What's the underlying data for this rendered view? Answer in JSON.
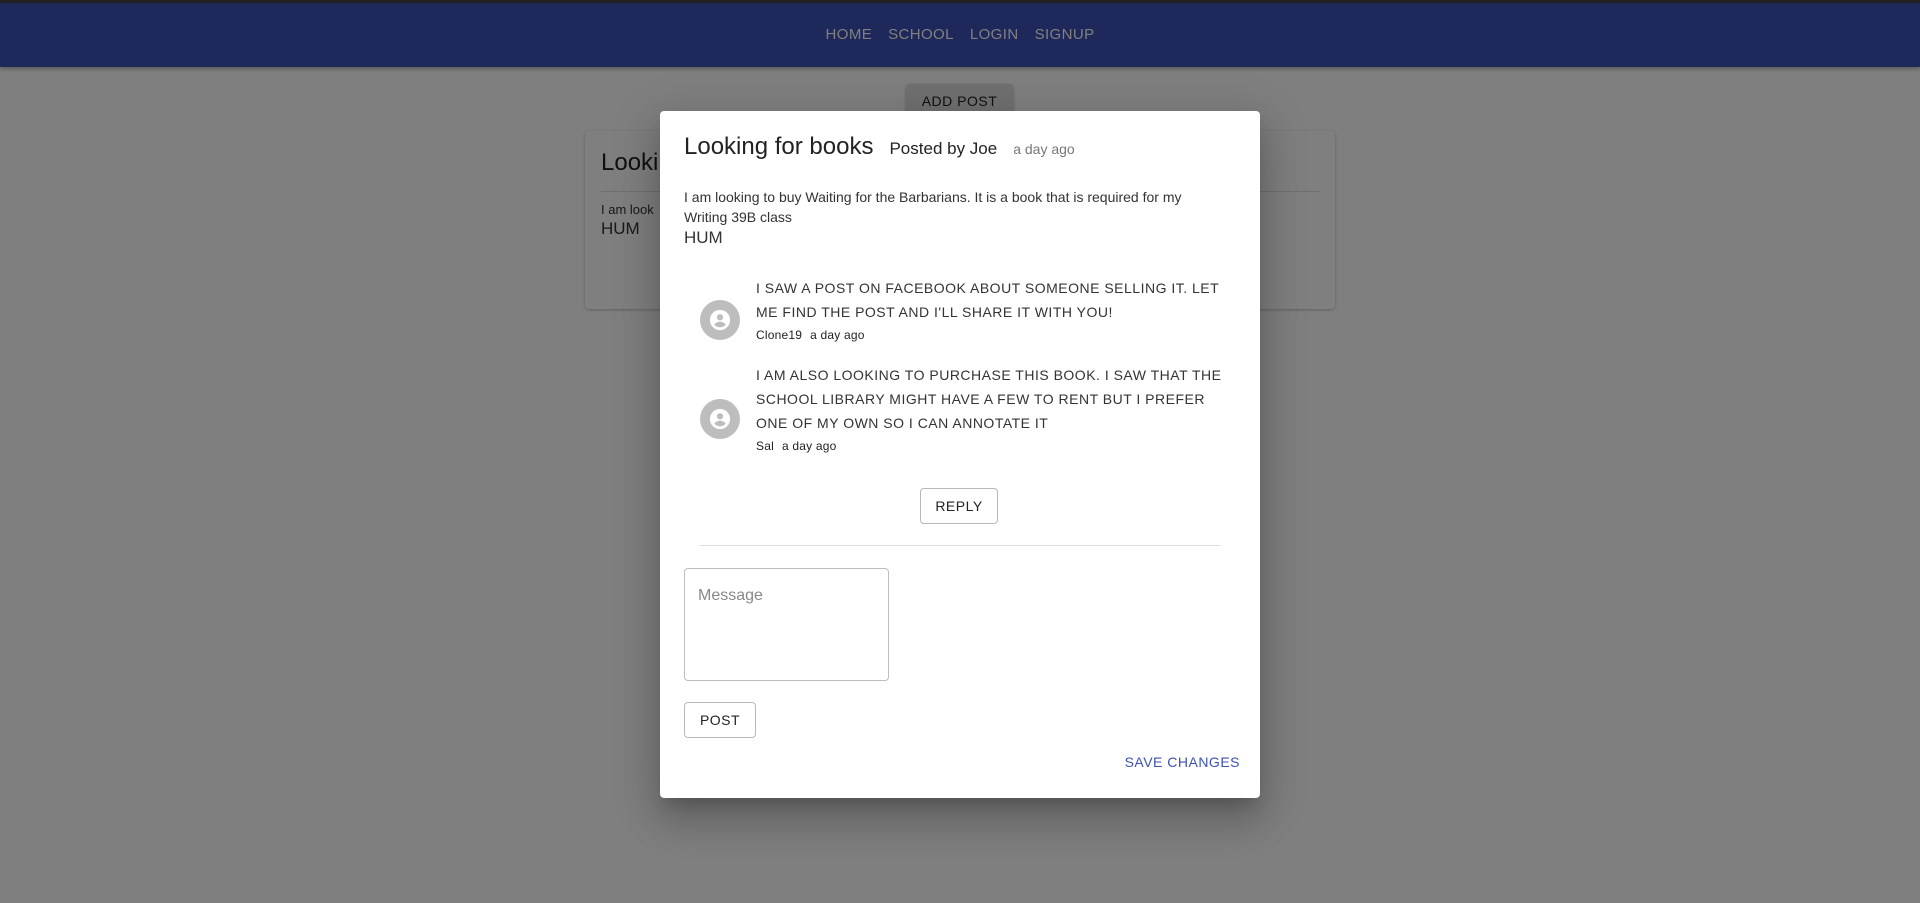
{
  "nav": {
    "items": [
      "HOME",
      "SCHOOL",
      "LOGIN",
      "SIGNUP"
    ]
  },
  "page": {
    "add_post_label": "ADD POST",
    "card": {
      "title": "Looki",
      "body": "I am look",
      "tag": "HUM"
    }
  },
  "dialog": {
    "title": "Looking for books",
    "posted_by": "Posted by Joe",
    "time": "a day ago",
    "body": "I am looking to buy Waiting for the Barbarians. It is a book that is required for my Writing 39B class",
    "tag": "HUM",
    "comments": [
      {
        "text": "I saw a post on Facebook about someone selling it. Let me find the post and I'll share it with you!",
        "author": "Clone19",
        "time": "a day ago"
      },
      {
        "text": "I am also looking to purchase this book. I saw that the school library might have a few to rent but I prefer one of my own so I can annotate it",
        "author": "Sal",
        "time": "a day ago"
      }
    ],
    "reply_label": "REPLY",
    "message_placeholder": "Message",
    "post_label": "POST",
    "save_label": "SAVE CHANGES"
  },
  "colors": {
    "appbar": "#3f51b5",
    "accent": "#3f51b5",
    "avatar": "#bdbdbd"
  },
  "icons": {
    "avatar": "account-circle-icon"
  }
}
